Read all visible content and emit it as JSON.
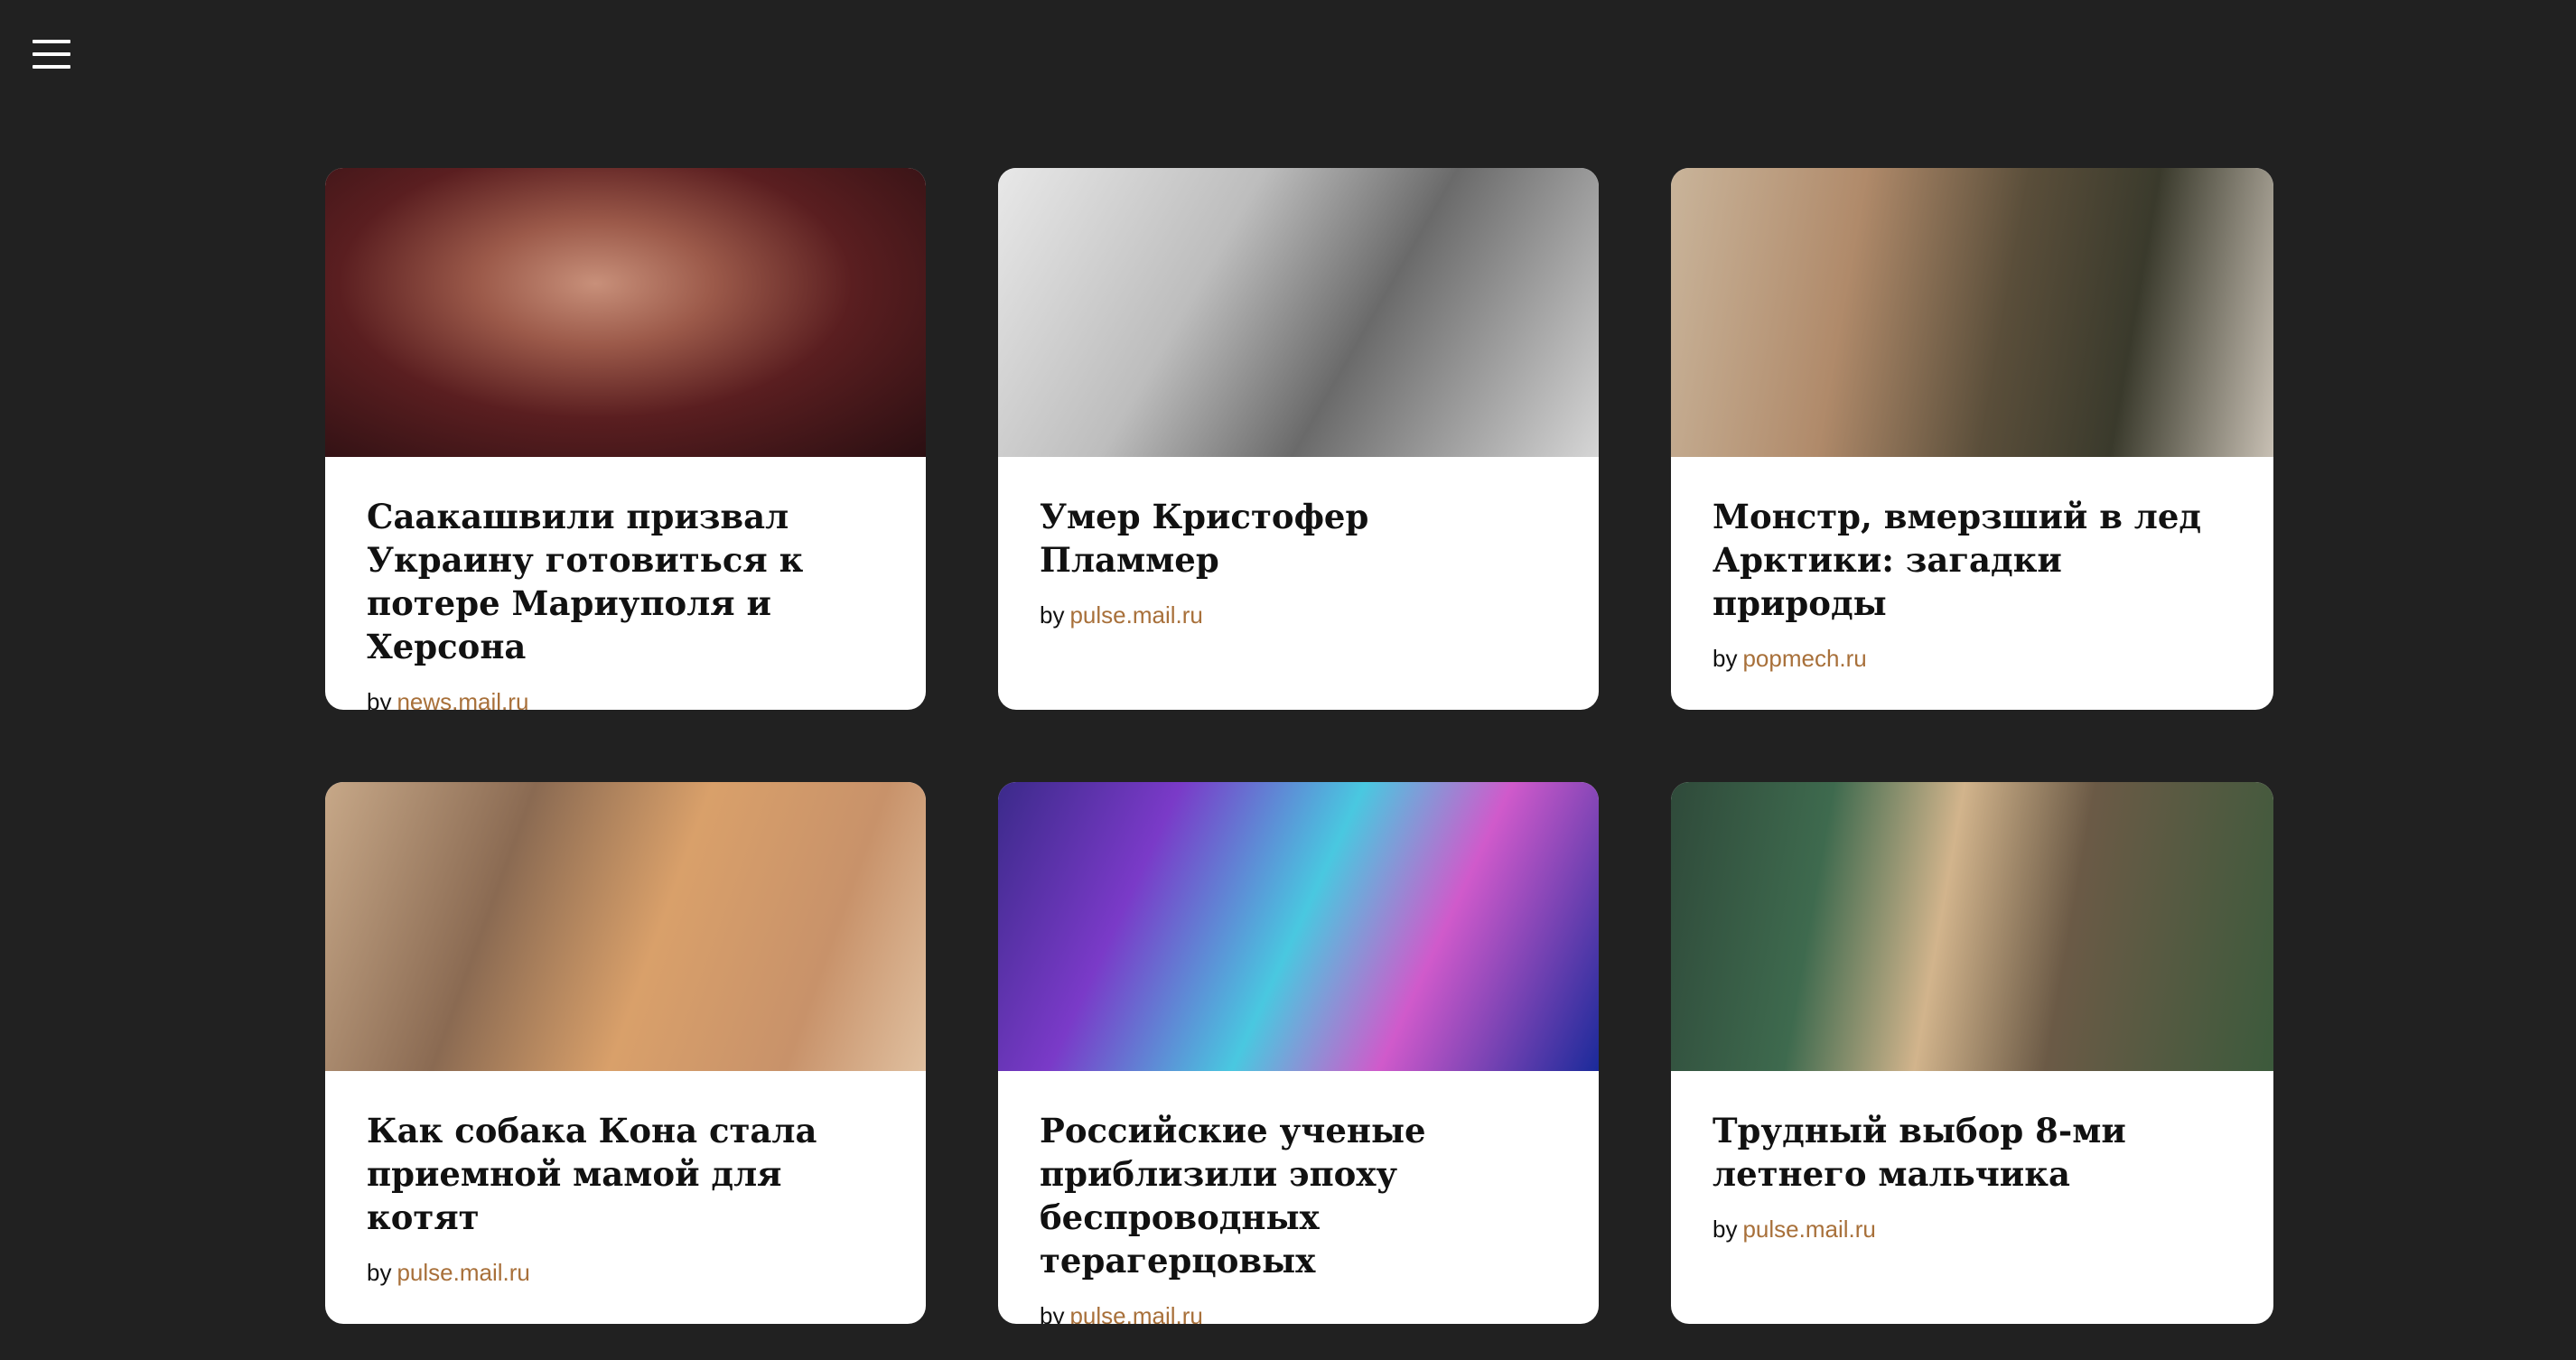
{
  "header": {
    "menu_icon": "hamburger-menu-icon"
  },
  "cards": [
    {
      "title": "Саакашвили призвал Украину готовиться к потере Мариуполя и Херсона",
      "by_label": "by",
      "source": "news.mail.ru",
      "image_alt": "photo"
    },
    {
      "title": "Умер Кристофер Пламмер",
      "by_label": "by",
      "source": "pulse.mail.ru",
      "image_alt": "photo"
    },
    {
      "title": "Монстр, вмерзший в лед Арктики: загадки природы",
      "by_label": "by",
      "source": "popmech.ru",
      "image_alt": "photo"
    },
    {
      "title": "Как собака Кона стала приемной мамой для котят",
      "by_label": "by",
      "source": "pulse.mail.ru",
      "image_alt": "photo"
    },
    {
      "title": "Российские ученые приблизили эпоху беспроводных терагерцовых",
      "by_label": "by",
      "source": "pulse.mail.ru",
      "image_alt": "photo"
    },
    {
      "title": "Трудный выбор 8-ми летнего мальчика",
      "by_label": "by",
      "source": "pulse.mail.ru",
      "image_alt": "photo"
    }
  ],
  "colors": {
    "background": "#212121",
    "card": "#ffffff",
    "source_link": "#a8703a"
  }
}
